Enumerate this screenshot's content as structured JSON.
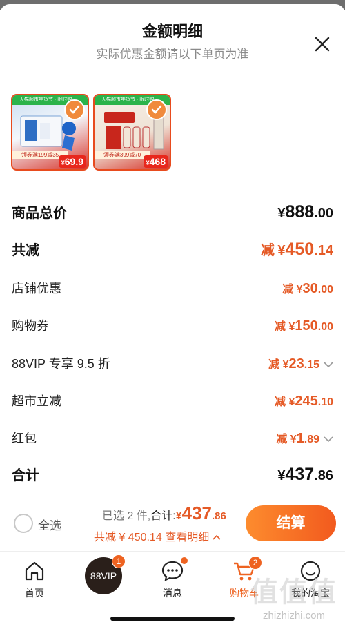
{
  "header": {
    "title": "金额明细",
    "subtitle": "实际优惠金额请以下单页为准"
  },
  "products": [
    {
      "banner": "天猫超市年货节 · 限时购",
      "coupon": "领券满199减35",
      "price_int": "69.9",
      "yen": "¥"
    },
    {
      "banner": "天猫超市年货节 · 限时购",
      "coupon": "领券满399减70",
      "price_int": "468",
      "yen": "¥"
    }
  ],
  "breakdown": {
    "total_label": "商品总价",
    "total_yen": "¥",
    "total_int": "888",
    "total_dec": ".00",
    "reduce_label": "共减",
    "reduce_prefix": "减",
    "reduce_yen": "¥",
    "reduce_int": "450",
    "reduce_dec": ".14",
    "items": [
      {
        "label": "店铺优惠",
        "prefix": "减",
        "yen": "¥",
        "int": "30",
        "dec": ".00",
        "expandable": false
      },
      {
        "label": "购物券",
        "prefix": "减",
        "yen": "¥",
        "int": "150",
        "dec": ".00",
        "expandable": false
      },
      {
        "label": "88VIP 专享 9.5 折",
        "prefix": "减",
        "yen": "¥",
        "int": "23",
        "dec": ".15",
        "expandable": true
      },
      {
        "label": "超市立减",
        "prefix": "减",
        "yen": "¥",
        "int": "245",
        "dec": ".10",
        "expandable": false
      },
      {
        "label": "红包",
        "prefix": "减",
        "yen": "¥",
        "int": "1",
        "dec": ".89",
        "expandable": true
      }
    ],
    "sum_label": "合计",
    "sum_yen": "¥",
    "sum_int": "437",
    "sum_dec": ".86"
  },
  "footer": {
    "select_all": "全选",
    "selected_text": "已选 2 件,",
    "total_label": "合计:",
    "total_yen": "¥",
    "total_int": "437",
    "total_dec": ".86",
    "reduce_text": "共减 ¥ 450.14",
    "details_link": "查看明细",
    "checkout": "结算"
  },
  "tabbar": {
    "home": "首页",
    "vip": "88VIP",
    "vip_badge": "1",
    "messages": "消息",
    "cart": "购物车",
    "cart_badge": "2",
    "mine": "我的淘宝"
  },
  "watermark": {
    "logo": "值值值",
    "url": "zhizhizhi.com"
  },
  "colors": {
    "accent": "#e55a26",
    "checkout_start": "#fd8c2e",
    "checkout_end": "#f25a1e"
  }
}
